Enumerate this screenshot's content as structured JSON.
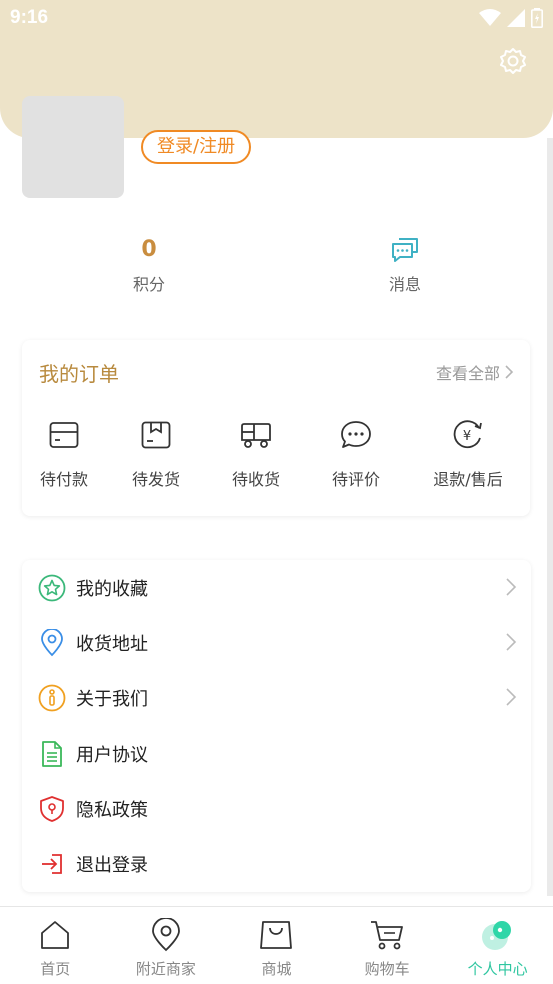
{
  "status_bar": {
    "time": "9:16"
  },
  "profile": {
    "login_label": "登录/注册"
  },
  "stats": {
    "points": {
      "value": "0",
      "label": "积分"
    },
    "messages": {
      "label": "消息"
    }
  },
  "orders": {
    "title": "我的订单",
    "view_all": "查看全部",
    "items": [
      {
        "label": "待付款",
        "icon": "card-icon"
      },
      {
        "label": "待发货",
        "icon": "box-icon"
      },
      {
        "label": "待收货",
        "icon": "truck-icon"
      },
      {
        "label": "待评价",
        "icon": "comment-icon"
      },
      {
        "label": "退款/售后",
        "icon": "refund-icon"
      }
    ]
  },
  "menu": [
    {
      "label": "我的收藏",
      "icon": "star-icon",
      "color": "#3bb87a"
    },
    {
      "label": "收货地址",
      "icon": "location-icon",
      "color": "#3a8ee6"
    },
    {
      "label": "关于我们",
      "icon": "info-icon",
      "color": "#f0a020"
    },
    {
      "label": "用户协议",
      "icon": "document-icon",
      "color": "#3bb85a"
    },
    {
      "label": "隐私政策",
      "icon": "shield-icon",
      "color": "#e03030"
    },
    {
      "label": "退出登录",
      "icon": "logout-icon",
      "color": "#e03030"
    }
  ],
  "tabbar": {
    "items": [
      {
        "label": "首页",
        "icon": "home-icon"
      },
      {
        "label": "附近商家",
        "icon": "location-pin-icon"
      },
      {
        "label": "商城",
        "icon": "shopping-bag-icon"
      },
      {
        "label": "购物车",
        "icon": "cart-icon"
      },
      {
        "label": "个人中心",
        "icon": "profile-icon"
      }
    ],
    "active_index": 4,
    "active_color": "#2fc6a0"
  },
  "colors": {
    "header_bg": "#ede3c8",
    "accent": "#f08a24",
    "gold": "#b88a3e"
  }
}
